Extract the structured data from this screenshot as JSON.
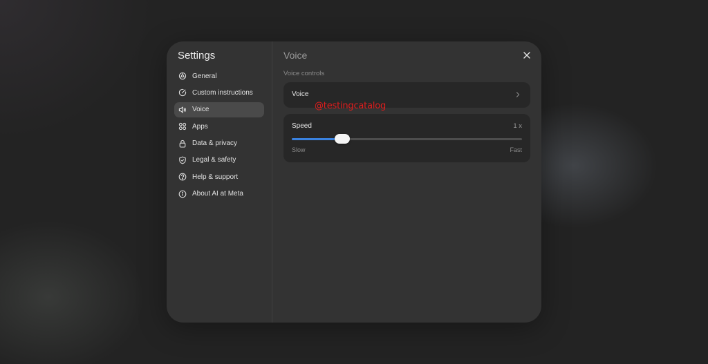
{
  "sidebar": {
    "title": "Settings",
    "items": [
      {
        "label": "General",
        "icon": "gear-icon",
        "active": false
      },
      {
        "label": "Custom instructions",
        "icon": "pencil-circle-icon",
        "active": false
      },
      {
        "label": "Voice",
        "icon": "speaker-icon",
        "active": true
      },
      {
        "label": "Apps",
        "icon": "apps-grid-icon",
        "active": false
      },
      {
        "label": "Data & privacy",
        "icon": "lock-icon",
        "active": false
      },
      {
        "label": "Legal & safety",
        "icon": "shield-icon",
        "active": false
      },
      {
        "label": "Help & support",
        "icon": "help-circle-icon",
        "active": false
      },
      {
        "label": "About AI at Meta",
        "icon": "info-circle-icon",
        "active": false
      }
    ]
  },
  "main": {
    "title": "Voice",
    "close_icon": "close-icon",
    "section_label": "Voice controls",
    "voice_row": {
      "label": "Voice",
      "icon": "chevron-right-icon"
    },
    "speed": {
      "label": "Speed",
      "value_text": "1 x",
      "slider_fraction": 0.22,
      "min_label": "Slow",
      "max_label": "Fast"
    }
  },
  "watermark": "@testingcatalog",
  "colors": {
    "accent": "#3a82e0",
    "modal_bg": "#333333",
    "card_bg": "#272727",
    "active_item_bg": "#4a4a4a",
    "watermark": "#e01d1d"
  }
}
